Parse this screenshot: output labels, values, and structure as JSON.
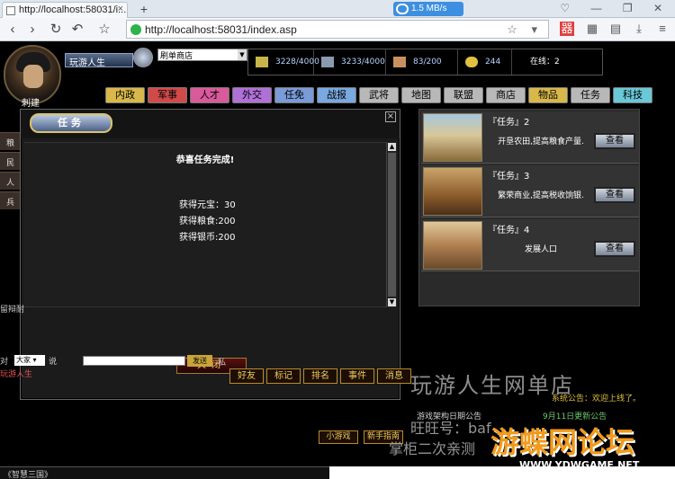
{
  "browser": {
    "tab_title": "http://localhost:58031/i...",
    "tab_close": "×",
    "new_tab": "+",
    "speed": "1.5 MB/s",
    "url": "http://localhost:58031/index.asp",
    "window_controls": "♡ — ❐ ✕",
    "url_tail": "☆ ▾"
  },
  "player": {
    "name": "玩游人生",
    "avatar_label": "刺建"
  },
  "shop_select": "刷单商店",
  "resources": [
    {
      "value": "3228/4000",
      "icon": "wheat-icon",
      "color": "#c8b54a"
    },
    {
      "value": "3233/4000",
      "icon": "ore-icon",
      "color": "#8a9bb0"
    },
    {
      "value": "83/200",
      "icon": "soldier-icon",
      "color": "#c89060"
    },
    {
      "value": "244",
      "icon": "gold-icon",
      "color": "#e2c040"
    },
    {
      "value": "在线：2",
      "icon": "",
      "color": "#ffffff"
    }
  ],
  "menu": [
    {
      "label": "内政",
      "color": "#d8b84a"
    },
    {
      "label": "军事",
      "color": "#d04a4a"
    },
    {
      "label": "人才",
      "color": "#d85a9a"
    },
    {
      "label": "外交",
      "color": "#b070d8"
    },
    {
      "label": "任免",
      "color": "#7a9ad8"
    },
    {
      "label": "战报",
      "color": "#7aa8e0"
    },
    {
      "label": "武将",
      "color": "#b8b8b8"
    },
    {
      "label": "地图",
      "color": "#b8b8b8"
    },
    {
      "label": "联盟",
      "color": "#b8b8b8"
    },
    {
      "label": "商店",
      "color": "#b8b8b8"
    },
    {
      "label": "物品",
      "color": "#d8b84a"
    },
    {
      "label": "任务",
      "color": "#b8b8b8"
    },
    {
      "label": "科技",
      "color": "#6ac8d8"
    }
  ],
  "side_tabs": [
    "粮",
    "民",
    "人",
    "兵"
  ],
  "modal": {
    "title": "任务",
    "close": "×",
    "message": "恭喜任务完成!",
    "rewards": [
      "获得元宝：30",
      "获得粮食:200",
      "获得银币:200"
    ],
    "button": "关闭"
  },
  "tasks": [
    {
      "title": "『任务』2",
      "desc": "开垦农田,提高粮食产量.",
      "button": "查看"
    },
    {
      "title": "『任务』3",
      "desc": "繁荣商业,提高税收饷银.",
      "button": "查看"
    },
    {
      "title": "『任务』4",
      "desc": "发展人口",
      "button": "查看"
    }
  ],
  "chat": {
    "left_label": "留辩耐",
    "prefix": "对",
    "channel": "大家",
    "say": "说",
    "send": "发送",
    "private": "私",
    "user": "玩游人生"
  },
  "social_buttons": [
    "好友",
    "标记",
    "排名",
    "事件",
    "消息"
  ],
  "bottom_buttons": [
    "小游戏",
    "新手指南"
  ],
  "news": [
    {
      "text": "游戏架构日期公告",
      "color": "#cfcfcf"
    },
    {
      "text": "系统公告：欢迎上线了。",
      "color": "#e0c040"
    },
    {
      "text": "9月11日更新公告",
      "color": "#6ac86a"
    }
  ],
  "overlay": {
    "title": "玩游人生网单店",
    "sub1": "旺旺号：baf",
    "sub2": "掌柜二次亲测"
  },
  "watermark": {
    "main": "游蝶网论坛",
    "url": "WWW.YDWGAME.NET"
  },
  "footer": "《智慧三国》"
}
